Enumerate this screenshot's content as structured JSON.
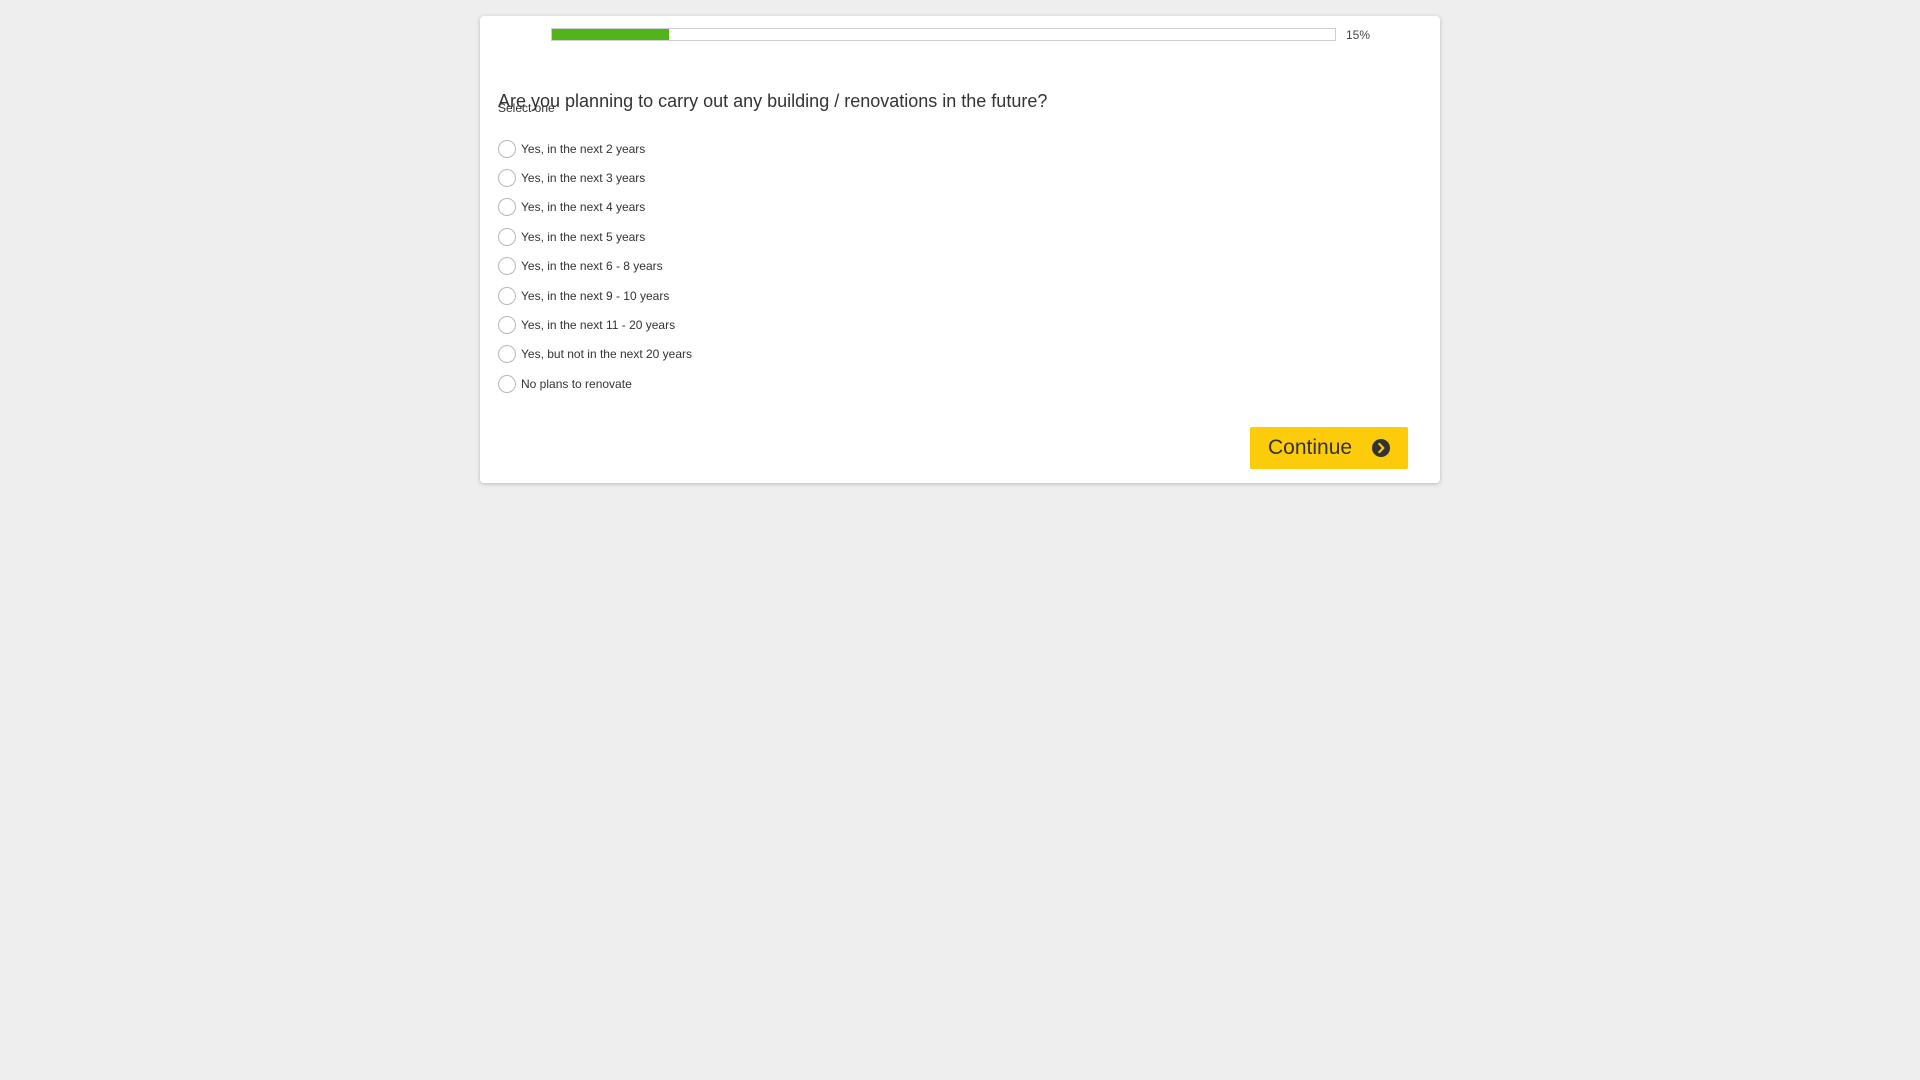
{
  "progress": {
    "value_percent": 15,
    "label": "15%",
    "color": "#53b31a"
  },
  "question": {
    "title": "Are you planning to carry out any building / renovations in the future?",
    "instruction": "Select one"
  },
  "options": [
    {
      "label": "Yes, in the next 2 years",
      "selected": false
    },
    {
      "label": "Yes, in the next 3 years",
      "selected": false
    },
    {
      "label": "Yes, in the next 4 years",
      "selected": false
    },
    {
      "label": "Yes, in the next 5 years",
      "selected": false
    },
    {
      "label": "Yes, in the next 6 - 8 years",
      "selected": false
    },
    {
      "label": "Yes, in the next 9 - 10 years",
      "selected": false
    },
    {
      "label": "Yes, in the next 11 - 20 years",
      "selected": false
    },
    {
      "label": "Yes, but not in the next 20 years",
      "selected": false
    },
    {
      "label": "No plans to renovate",
      "selected": false
    }
  ],
  "continue_button": {
    "label": "Continue",
    "icon": "chevron-right-circle-icon",
    "color": "#fccc0a"
  }
}
